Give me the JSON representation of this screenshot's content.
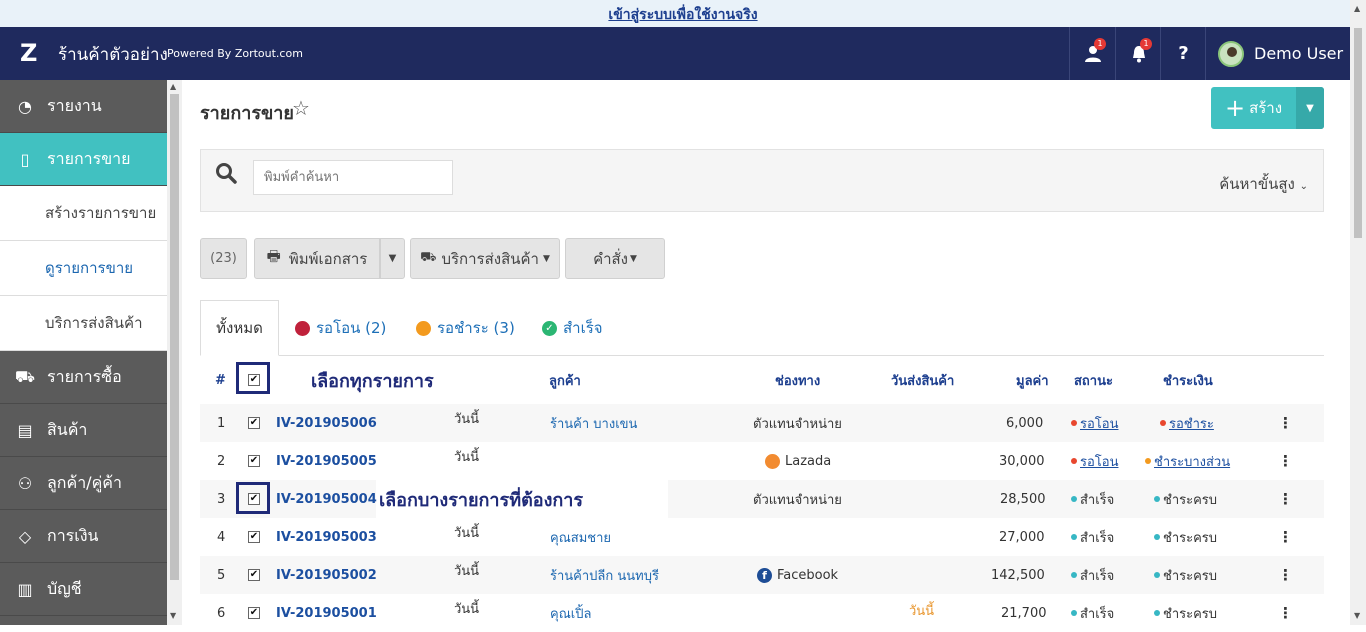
{
  "banner": {
    "link": "เข้าสู่ระบบเพื่อใช้งานจริง"
  },
  "topbar": {
    "logo": "Z",
    "shop_name": "ร้านค้าตัวอย่าง",
    "powered": "Powered By Zortout.com",
    "user_badge": "1",
    "bell_badge": "1",
    "help": "?",
    "user_name": "Demo User"
  },
  "sidebar": {
    "items": [
      {
        "label": "รายงาน",
        "icon": "dashboard-gauge-icon"
      },
      {
        "label": "รายการขาย",
        "icon": "document-icon"
      },
      {
        "label": "รายการซื้อ",
        "icon": "cart-icon"
      },
      {
        "label": "สินค้า",
        "icon": "box-icon"
      },
      {
        "label": "ลูกค้า/คู่ค้า",
        "icon": "users-icon"
      },
      {
        "label": "การเงิน",
        "icon": "tag-icon"
      },
      {
        "label": "บัญชี",
        "icon": "ledger-icon"
      }
    ],
    "sub_items": [
      "สร้างรายการขาย",
      "ดูรายการขาย",
      "บริการส่งสินค้า"
    ]
  },
  "page": {
    "title": "รายการขาย",
    "create_label": "สร้าง",
    "search_placeholder": "พิมพ์คำค้นหา",
    "advanced_search": "ค้นหาขั้นสูง"
  },
  "toolbar": {
    "count": "(23)",
    "print": "พิมพ์เอกสาร",
    "shipping": "บริการส่งสินค้า",
    "command": "คำสั่ง"
  },
  "tabs": [
    "ทั้งหมด",
    "รอโอน (2)",
    "รอชำระ (3)",
    "สำเร็จ"
  ],
  "annotations": {
    "select_all": "เลือกทุกรายการ",
    "select_some": "เลือกบางรายการที่ต้องการ"
  },
  "table": {
    "headers": {
      "num": "#",
      "customer": "ลูกค้า",
      "channel": "ช่องทาง",
      "ship_date": "วันส่งสินค้า",
      "value": "มูลค่า",
      "status": "สถานะ",
      "payment": "ชำระเงิน"
    },
    "rows": [
      {
        "num": "1",
        "id": "IV-201905006",
        "date": "วันนี้",
        "customer": "ร้านค้า บางเขน",
        "channel": "ตัวแทนจำหน่าย",
        "ship_date": "",
        "value": "6,000",
        "status": "รอโอน",
        "payment": "รอชำระ"
      },
      {
        "num": "2",
        "id": "IV-201905005",
        "date": "วันนี้",
        "customer": "",
        "channel": "Lazada",
        "ship_date": "",
        "value": "30,000",
        "status": "รอโอน",
        "payment": "ชำระบางส่วน"
      },
      {
        "num": "3",
        "id": "IV-201905004",
        "date": "",
        "customer": "",
        "channel": "ตัวแทนจำหน่าย",
        "ship_date": "",
        "value": "28,500",
        "status": "สำเร็จ",
        "payment": "ชำระครบ"
      },
      {
        "num": "4",
        "id": "IV-201905003",
        "date": "วันนี้",
        "customer": "คุณสมชาย",
        "channel": "",
        "ship_date": "",
        "value": "27,000",
        "status": "สำเร็จ",
        "payment": "ชำระครบ"
      },
      {
        "num": "5",
        "id": "IV-201905002",
        "date": "วันนี้",
        "customer": "ร้านค้าปลีก นนทบุรี",
        "channel": "Facebook",
        "ship_date": "",
        "value": "142,500",
        "status": "สำเร็จ",
        "payment": "ชำระครบ"
      },
      {
        "num": "6",
        "id": "IV-201905001",
        "date": "วันนี้",
        "customer": "คุณเปิ้ล",
        "channel": "",
        "ship_date": "วันนี้",
        "value": "21,700",
        "status": "สำเร็จ",
        "payment": "ชำระครบ"
      }
    ]
  },
  "colors": {
    "navy": "#1f2a5e",
    "teal": "#41c1c1",
    "red_dot": "#e8472e",
    "orange_dot": "#f39a1e",
    "teal_dot": "#37b7c4"
  }
}
